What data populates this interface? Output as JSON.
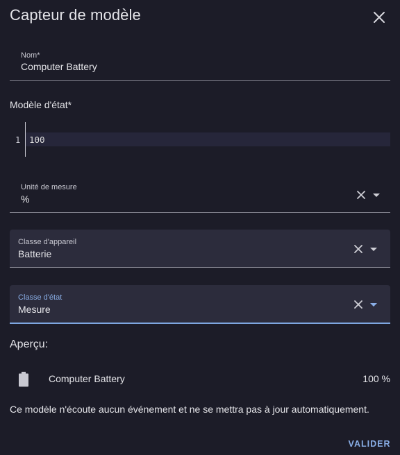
{
  "dialog": {
    "title": "Capteur de modèle",
    "close_icon": "close-icon"
  },
  "name_field": {
    "label": "Nom*",
    "value": "Computer Battery"
  },
  "state_template": {
    "label": "Modèle d'état*",
    "line_number": "1",
    "code": "100"
  },
  "unit_field": {
    "label": "Unité de mesure",
    "value": "%",
    "clear_icon": "close-icon",
    "dropdown_icon": "caret-down-icon"
  },
  "device_class_field": {
    "label": "Classe d'appareil",
    "value": "Batterie",
    "clear_icon": "close-icon",
    "dropdown_icon": "caret-down-icon"
  },
  "state_class_field": {
    "label": "Classe d'état",
    "value": "Mesure",
    "clear_icon": "close-icon",
    "dropdown_icon": "caret-down-icon",
    "focused": true
  },
  "preview": {
    "label": "Aperçu:",
    "entity_icon": "battery-icon",
    "entity_name": "Computer Battery",
    "entity_state": "100 %",
    "notice": "Ce modèle n'écoute aucun événement et ne se mettra pas à jour automatiquement."
  },
  "actions": {
    "submit_label": "VALIDER"
  },
  "colors": {
    "background": "#1c1c28",
    "field_fill": "#2c2c3c",
    "accent": "#89aee6"
  }
}
